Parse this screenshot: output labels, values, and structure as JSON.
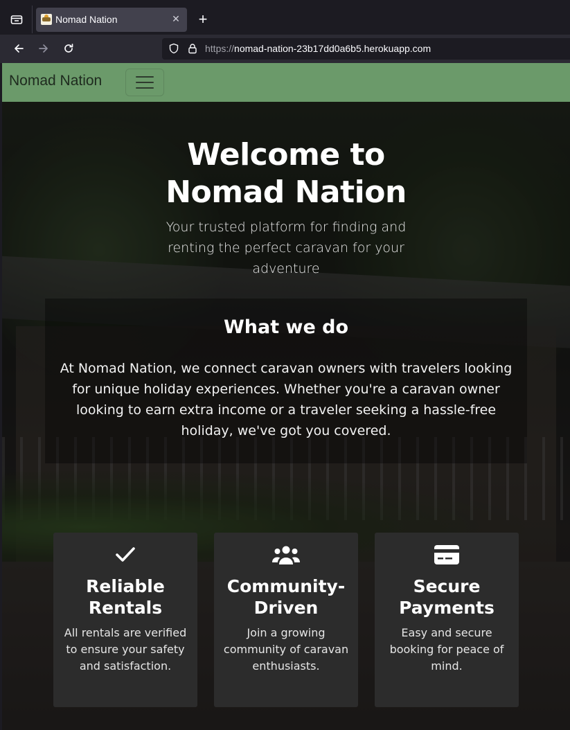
{
  "browser": {
    "tab_title": "Nomad Nation",
    "url_scheme": "https://",
    "url_host": "nomad-nation-23b17dd0a6b5.herokuapp.com",
    "new_tab": "+",
    "tab_close": "✕"
  },
  "site": {
    "brand": "Nomad Nation",
    "nav_color": "#6b9a6a"
  },
  "hero": {
    "title_line1": "Welcome to",
    "title_line2": "Nomad Nation",
    "subtitle": "Your trusted platform for finding and renting the perfect caravan for your adventure"
  },
  "about": {
    "title": "What we do",
    "text": "At Nomad Nation, we connect caravan owners with travelers looking for unique holiday experiences. Whether you're a caravan owner looking to earn extra income or a traveler seeking a hassle-free holiday, we've got you covered."
  },
  "features": [
    {
      "icon": "check-icon",
      "title": "Reliable Rentals",
      "text": "All rentals are verified to ensure your safety and satisfaction."
    },
    {
      "icon": "users-icon",
      "title": "Community-Driven",
      "text": "Join a growing community of caravan enthusiasts."
    },
    {
      "icon": "credit-card-icon",
      "title": "Secure Payments",
      "text": "Easy and secure booking for peace of mind."
    }
  ]
}
